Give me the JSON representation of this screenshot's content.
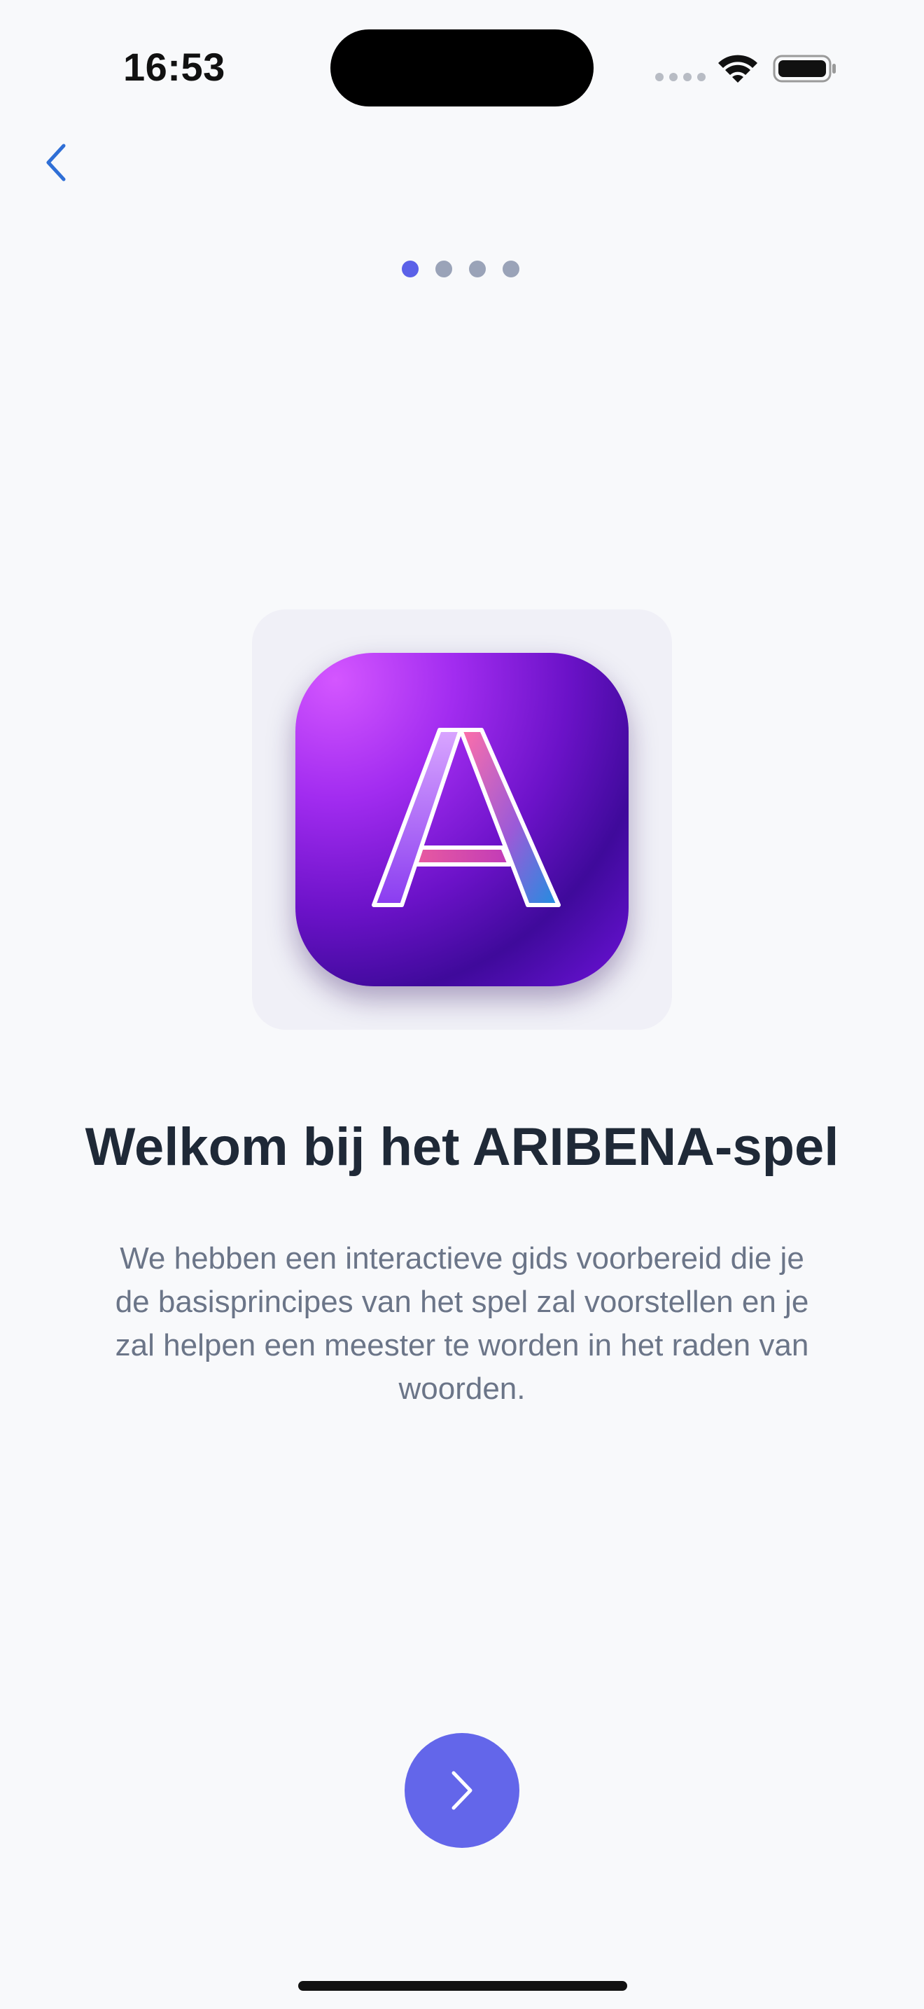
{
  "status_bar": {
    "time": "16:53",
    "wifi_icon": "wifi-icon",
    "battery_icon": "battery-full-icon"
  },
  "nav": {
    "back_icon": "chevron-left-icon",
    "accent_color": "#2f6fd6"
  },
  "pager": {
    "total": 4,
    "current": 1,
    "active_color": "#5b61e8",
    "inactive_color": "#9aa3b8"
  },
  "onboarding": {
    "logo_icon": "letter-a-app-icon",
    "title": "Welkom bij het ARIBENA-spel",
    "description": "We hebben een interactieve gids voorbereid die je de basisprincipes van het spel zal voorstellen en je zal helpen een meester te worden in het raden van woorden."
  },
  "next_button": {
    "icon": "chevron-right-icon",
    "color": "#6366ea"
  }
}
